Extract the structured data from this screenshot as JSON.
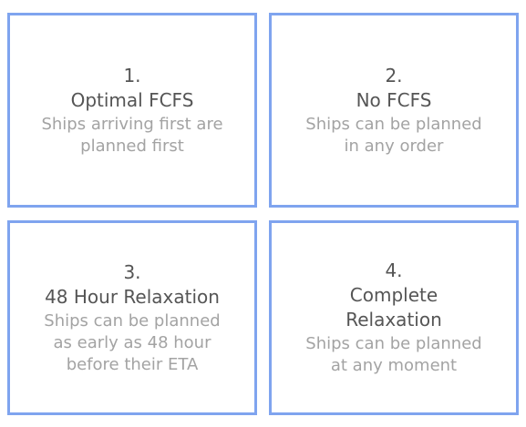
{
  "cards": [
    {
      "number": "1.",
      "title": "Optimal FCFS",
      "description": "Ships arriving first are\nplanned first"
    },
    {
      "number": "2.",
      "title": "No FCFS",
      "description": "Ships can be planned\nin any order"
    },
    {
      "number": "3.",
      "title": "48 Hour Relaxation",
      "description": "Ships can be planned\nas early as 48 hour\nbefore their ETA"
    },
    {
      "number": "4.",
      "title": "Complete\nRelaxation",
      "description": "Ships can be planned\nat any moment"
    }
  ],
  "colors": {
    "border": "#7fa4ef",
    "title_text": "#555555",
    "description_text": "#a3a3a3"
  }
}
